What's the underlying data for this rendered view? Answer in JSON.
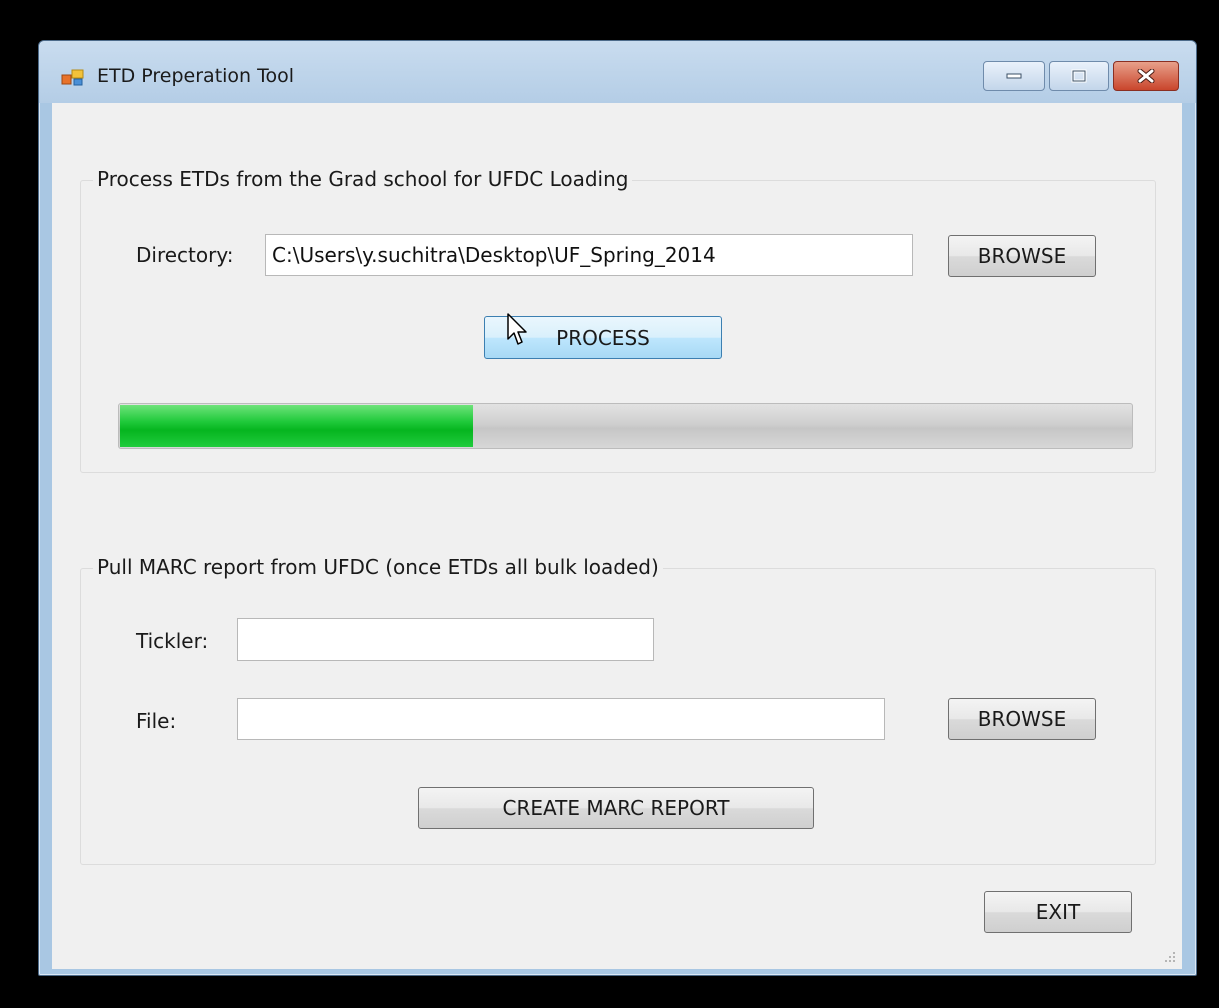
{
  "window": {
    "title": "ETD Preperation Tool"
  },
  "process_group": {
    "legend": "Process ETDs from the Grad school for UFDC Loading",
    "directory_label": "Directory:",
    "directory_value": "C:\\Users\\y.suchitra\\Desktop\\UF_Spring_2014",
    "browse_label": "BROWSE",
    "process_label": "PROCESS",
    "progress_fraction": 0.35
  },
  "marc_group": {
    "legend": "Pull MARC report from UFDC (once ETDs all bulk loaded)",
    "tickler_label": "Tickler:",
    "tickler_value": "",
    "file_label": "File:",
    "file_value": "",
    "browse_label": "BROWSE",
    "create_label": "CREATE MARC REPORT"
  },
  "footer": {
    "exit_label": "EXIT"
  },
  "colors": {
    "progress_fill": "#06b51f",
    "close_button": "#c9452c"
  }
}
